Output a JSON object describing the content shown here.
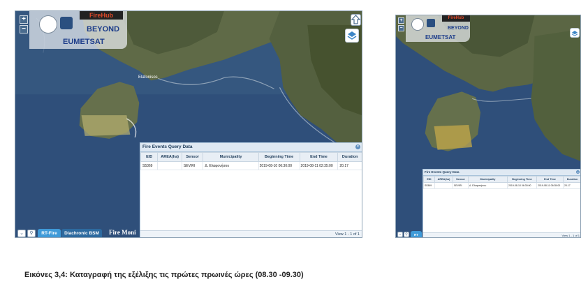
{
  "left": {
    "zoom_in": "+",
    "zoom_out": "−",
    "logos": {
      "firehub": "FireHub",
      "beyond": "BEYOND",
      "eumetsat": "EUMETSAT"
    },
    "place_label": "Elafonisos",
    "query": {
      "title": "Fire Events Query Data",
      "columns": [
        "EID",
        "AREA(ha)",
        "Sensor",
        "Municipality",
        "Beginning Time",
        "End Time",
        "Duration"
      ],
      "rows": [
        [
          "S5369",
          "",
          "SEVIRI",
          "Δ. Ελαφονήσου",
          "2019-08-10 06:30:00",
          "2019-08-11 02:35:00",
          "20.17"
        ]
      ],
      "footer": "View 1 - 1 of 1"
    },
    "tabs": {
      "rt": "RT-Fire",
      "dbsm": "Diachronic BSM"
    },
    "watermark": "Fire Moni"
  },
  "right": {
    "zoom_in": "+",
    "zoom_out": "−",
    "logos": {
      "firehub": "FireHub",
      "beyond": "BEYOND",
      "eumetsat": "EUMETSAT"
    },
    "query": {
      "title": "Fire Events Query Data",
      "columns": [
        "EID",
        "AREA(ha)",
        "Sensor",
        "Municipality",
        "Beginning Time",
        "End Time",
        "Duration"
      ],
      "rows": [
        [
          "S5369",
          "",
          "SEVIRI",
          "Δ. Ελαφονήσου",
          "2019-08-10 06:30:00",
          "2019-08-11 06:35:00",
          "20.17"
        ]
      ],
      "footer": "View 1 - 1 of 1"
    },
    "tabs": {
      "rt": "RT"
    }
  },
  "caption": "Εικόνες 3,4: Καταγραφή της εξέλιξης τις πρώτες πρωινές ώρες (08.30 -09.30)"
}
